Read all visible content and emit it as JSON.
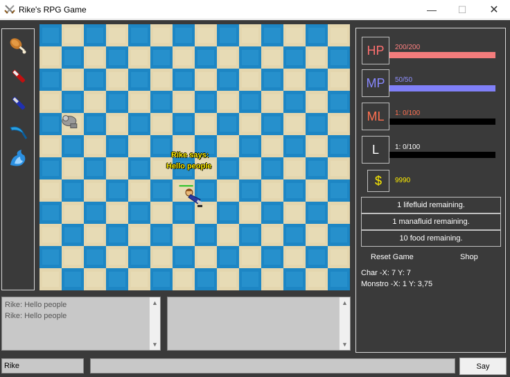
{
  "window": {
    "title": "Rike's RPG Game",
    "minimize_glyph": "—",
    "maximize_glyph": "☐",
    "close_glyph": "✕",
    "icon": "crossed-swords-icon"
  },
  "inventory": {
    "items": [
      {
        "name": "meat-food-icon"
      },
      {
        "name": "red-lifefluid-potion-icon"
      },
      {
        "name": "blue-manafluid-potion-icon"
      },
      {
        "name": "blue-crescent-blade-icon"
      },
      {
        "name": "ice-fire-spell-icon"
      }
    ]
  },
  "board": {
    "columns": 14,
    "rows": 12,
    "tile_colors": {
      "sand": "#e4d6ae",
      "water": "#1d86c4"
    },
    "speech_name": "Rike says:",
    "speech_text": "Hello people",
    "player": {
      "name": "Rike",
      "x": 7,
      "y": 7
    },
    "monster": {
      "name": "Monstro",
      "x": 1,
      "y": 3.75
    }
  },
  "chat": {
    "log": [
      "Rike: Hello people",
      "Rike: Hello people"
    ],
    "scroll_up_glyph": "▲",
    "scroll_down_glyph": "▼"
  },
  "stats": {
    "hp": {
      "label": "HP",
      "value": "200/200",
      "fill": 1.0,
      "color": "#f47c7c",
      "label_color": "#ff7070"
    },
    "mp": {
      "label": "MP",
      "value": "50/50",
      "fill": 1.0,
      "color": "#8080f8",
      "label_color": "#8888ff"
    },
    "ml": {
      "label": "ML",
      "value": "1: 0/100",
      "fill": 0.0,
      "color": "#f07050",
      "label_color": "#ff7050"
    },
    "level": {
      "label": "L",
      "value": "1: 0/100",
      "fill": 0.0,
      "color": "#ffffff",
      "label_color": "#ffffff"
    },
    "money": {
      "symbol": "$",
      "value": "9990"
    },
    "messages": [
      "1 lifefluid remaining.",
      "1 manafluid remaining.",
      "10 food remaining."
    ],
    "reset_label": "Reset Game",
    "shop_label": "Shop",
    "char_coords": "Char -X: 7 Y: 7",
    "monster_coords": "Monstro -X: 1 Y: 3,75"
  },
  "bottom": {
    "name_value": "Rike",
    "chat_value": "",
    "say_label": "Say"
  }
}
